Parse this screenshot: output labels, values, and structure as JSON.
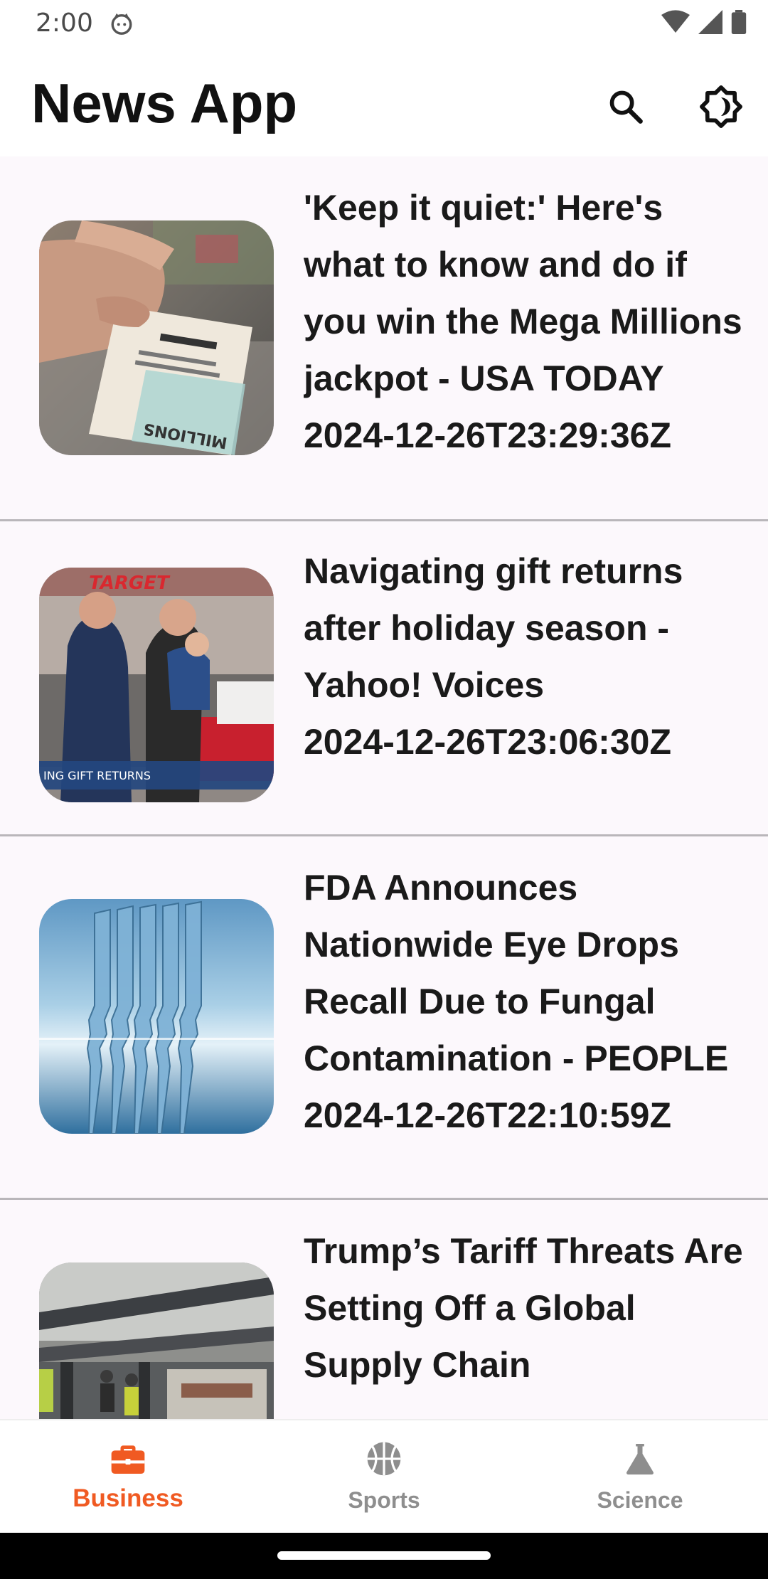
{
  "status_bar": {
    "time": "2:00"
  },
  "app_bar": {
    "title": "News App",
    "search_icon": "search-icon",
    "theme_icon": "brightness-auto-icon"
  },
  "articles": [
    {
      "title": "'Keep it quiet:' Here's what to know and do if you win the Mega Millions jackpot - USA TODAY",
      "published": "2024-12-26T23:29:36Z",
      "image": "lottery-ticket-photo"
    },
    {
      "title": "Navigating gift returns after holiday season - Yahoo! Voices",
      "published": "2024-12-26T23:06:30Z",
      "image": "store-returns-photo",
      "image_caption": "ING GIFT RETURNS",
      "image_sign": "TARGET"
    },
    {
      "title": "FDA Announces Nationwide Eye Drops Recall Due to Fungal Contamination - PEOPLE",
      "published": "2024-12-26T22:10:59Z",
      "image": "eye-drop-vials-photo"
    },
    {
      "title": "Trump’s Tariff Threats Are Setting Off a Global Supply Chain",
      "published": "",
      "image": "shipping-port-photo"
    }
  ],
  "bottom_nav": {
    "items": [
      {
        "label": "Business",
        "icon": "briefcase-icon",
        "active": true
      },
      {
        "label": "Sports",
        "icon": "basketball-icon",
        "active": false
      },
      {
        "label": "Science",
        "icon": "flask-icon",
        "active": false
      }
    ]
  },
  "colors": {
    "accent": "#f05a22",
    "inactive": "#8e8e8e",
    "background": "#fcf8fc",
    "divider": "#b9b6ba"
  }
}
